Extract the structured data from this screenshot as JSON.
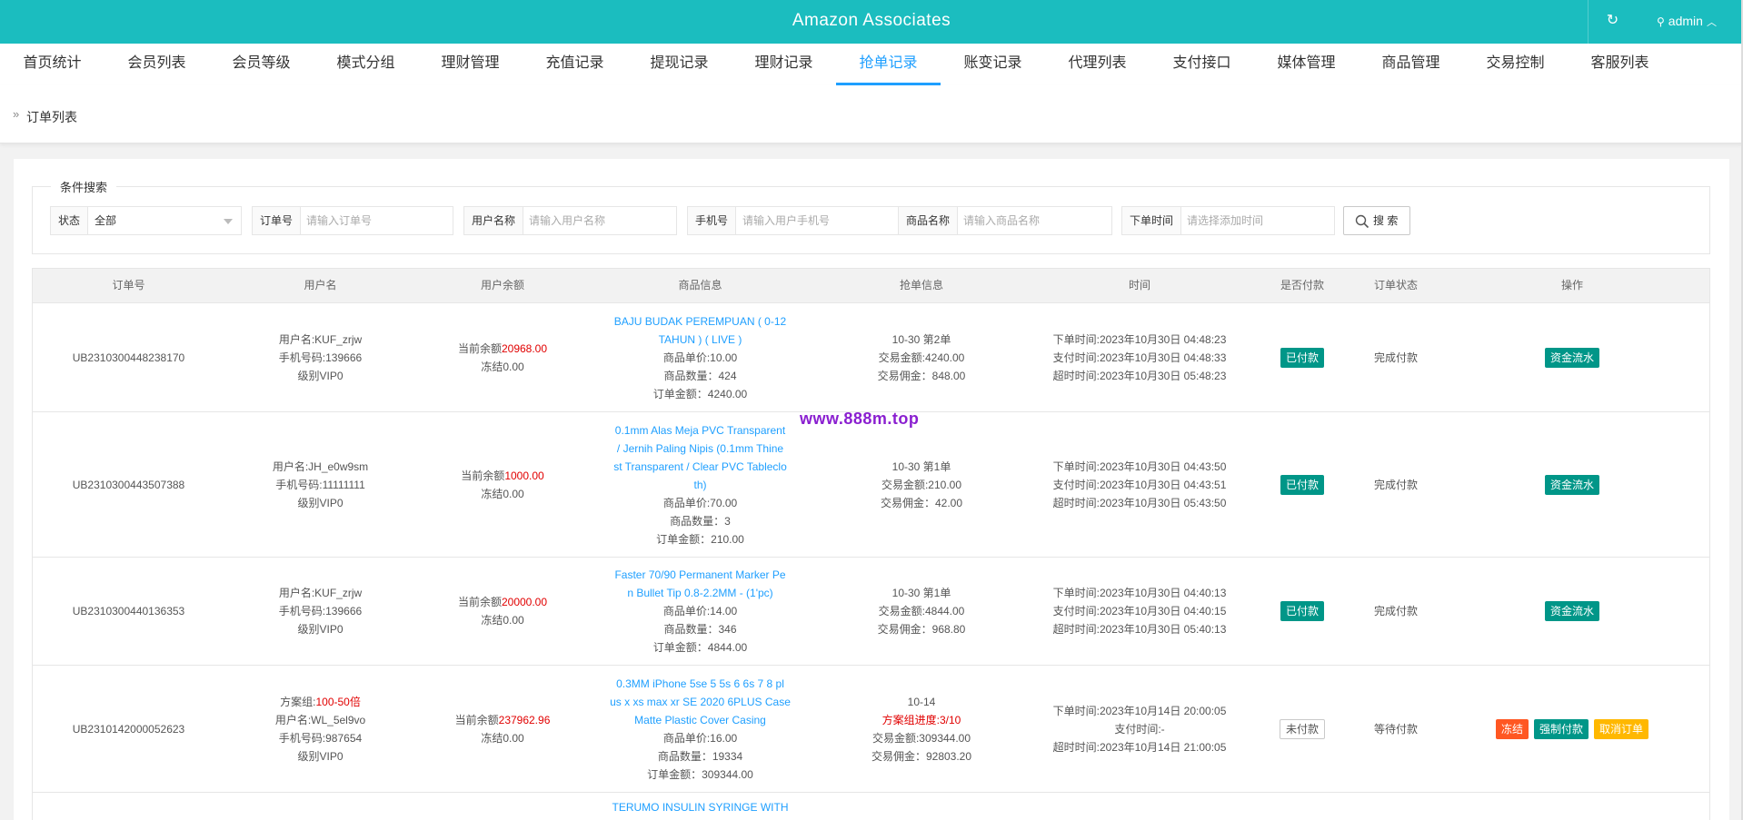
{
  "header": {
    "title": "Amazon Associates",
    "refresh_icon": "↻",
    "user_icon": "⚲",
    "user": "admin",
    "user_caret": "︿"
  },
  "nav": [
    {
      "label": "首页统计",
      "active": false
    },
    {
      "label": "会员列表",
      "active": false
    },
    {
      "label": "会员等级",
      "active": false
    },
    {
      "label": "模式分组",
      "active": false
    },
    {
      "label": "理财管理",
      "active": false
    },
    {
      "label": "充值记录",
      "active": false
    },
    {
      "label": "提现记录",
      "active": false
    },
    {
      "label": "理财记录",
      "active": false
    },
    {
      "label": "抢单记录",
      "active": true
    },
    {
      "label": "账变记录",
      "active": false
    },
    {
      "label": "代理列表",
      "active": false
    },
    {
      "label": "支付接口",
      "active": false
    },
    {
      "label": "媒体管理",
      "active": false
    },
    {
      "label": "商品管理",
      "active": false
    },
    {
      "label": "交易控制",
      "active": false
    },
    {
      "label": "客服列表",
      "active": false
    }
  ],
  "breadcrumb": {
    "arrow": "»",
    "label": "订单列表"
  },
  "search": {
    "legend": "条件搜索",
    "status_label": "状态",
    "status_value": "全部",
    "order_label": "订单号",
    "order_placeholder": "请输入订单号",
    "username_label": "用户名称",
    "username_placeholder": "请输入用户名称",
    "phone_label": "手机号",
    "phone_placeholder": "请输入用户手机号",
    "goods_label": "商品名称",
    "goods_placeholder": "请输入商品名称",
    "time_label": "下单时间",
    "time_placeholder": "请选择添加时间",
    "button": "搜 索"
  },
  "table": {
    "columns": [
      "订单号",
      "用户名",
      "用户余额",
      "商品信息",
      "抢单信息",
      "时间",
      "是否付款",
      "订单状态",
      "操作"
    ],
    "rows": [
      {
        "order_no": "UB2310300448238170",
        "user": [
          "用户名:KUF_zrjw",
          "手机号码:139666",
          "级别VIP0"
        ],
        "balance_label": "当前余额",
        "balance": "20968.00",
        "frozen": "冻结0.00",
        "goods_title": [
          "BAJU BUDAK PEREMPUAN ( 0-12",
          "TAHUN ) ( LIVE )"
        ],
        "goods_info": [
          "商品单价:10.00",
          "商品数量：424",
          "订单金额：4240.00"
        ],
        "grab": [
          "10-30 第2单",
          "交易金额:4240.00",
          "交易佣金：848.00"
        ],
        "time": [
          "下单时间:2023年10月30日 04:48:23",
          "支付时间:2023年10月30日 04:48:33",
          "超时时间:2023年10月30日 05:48:23"
        ],
        "paid": "已付款",
        "status": "完成付款",
        "action": "资金流水"
      },
      {
        "order_no": "UB2310300443507388",
        "user": [
          "用户名:JH_e0w9sm",
          "手机号码:11111111",
          "级别VIP0"
        ],
        "balance_label": "当前余额",
        "balance": "1000.00",
        "frozen": "冻结0.00",
        "goods_title": [
          "0.1mm Alas Meja PVC Transparent",
          "/ Jernih Paling Nipis (0.1mm Thine",
          "st Transparent / Clear PVC Tableclo",
          "th)"
        ],
        "goods_info": [
          "商品单价:70.00",
          "商品数量：3",
          "订单金额：210.00"
        ],
        "grab": [
          "10-30 第1单",
          "交易金额:210.00",
          "交易佣金：42.00"
        ],
        "time": [
          "下单时间:2023年10月30日 04:43:50",
          "支付时间:2023年10月30日 04:43:51",
          "超时时间:2023年10月30日 05:43:50"
        ],
        "paid": "已付款",
        "status": "完成付款",
        "action": "资金流水"
      },
      {
        "order_no": "UB2310300440136353",
        "user": [
          "用户名:KUF_zrjw",
          "手机号码:139666",
          "级别VIP0"
        ],
        "balance_label": "当前余额",
        "balance": "20000.00",
        "frozen": "冻结0.00",
        "goods_title": [
          "Faster 70/90 Permanent Marker Pe",
          "n Bullet Tip 0.8-2.2MM - (1'pc)"
        ],
        "goods_info": [
          "商品单价:14.00",
          "商品数量：346",
          "订单金额：4844.00"
        ],
        "grab": [
          "10-30 第1单",
          "交易金额:4844.00",
          "交易佣金：968.80"
        ],
        "time": [
          "下单时间:2023年10月30日 04:40:13",
          "支付时间:2023年10月30日 04:40:15",
          "超时时间:2023年10月30日 05:40:13"
        ],
        "paid": "已付款",
        "status": "完成付款",
        "action": "资金流水"
      },
      {
        "order_no": "UB2310142000052623",
        "group_label": "方案组:",
        "group_value": "100-50倍",
        "user": [
          "用户名:WL_5el9vo",
          "手机号码:987654",
          "级别VIP0"
        ],
        "balance_label": "当前余额",
        "balance": "237962.96",
        "frozen": "冻结0.00",
        "goods_title": [
          "0.3MM iPhone 5se 5 5s 6 6s 7 8 pl",
          "us x xs max xr SE 2020 6PLUS Case",
          "Matte Plastic Cover Casing"
        ],
        "goods_info": [
          "商品单价:16.00",
          "商品数量：19334",
          "订单金额：309344.00"
        ],
        "grab_date": "10-14",
        "grab_progress": "方案组进度:3/10",
        "grab": [
          "交易金额:309344.00",
          "交易佣金：92803.20"
        ],
        "time": [
          "下单时间:2023年10月14日 20:00:05",
          "支付时间:-",
          "超时时间:2023年10月14日 21:00:05"
        ],
        "paid": "未付款",
        "status": "等待付款",
        "actions": [
          "冻结",
          "强制付款",
          "取消订单"
        ]
      },
      {
        "goods_title": [
          "TERUMO INSULIN SYRINGE WITH"
        ]
      }
    ]
  },
  "watermark": "www.888m.top",
  "colors": {
    "topbar": "#1bbdbf",
    "accent": "#1e9fff",
    "success": "#009688",
    "danger": "#ff5722",
    "warn": "#ffb800",
    "red_text": "#e10000"
  }
}
